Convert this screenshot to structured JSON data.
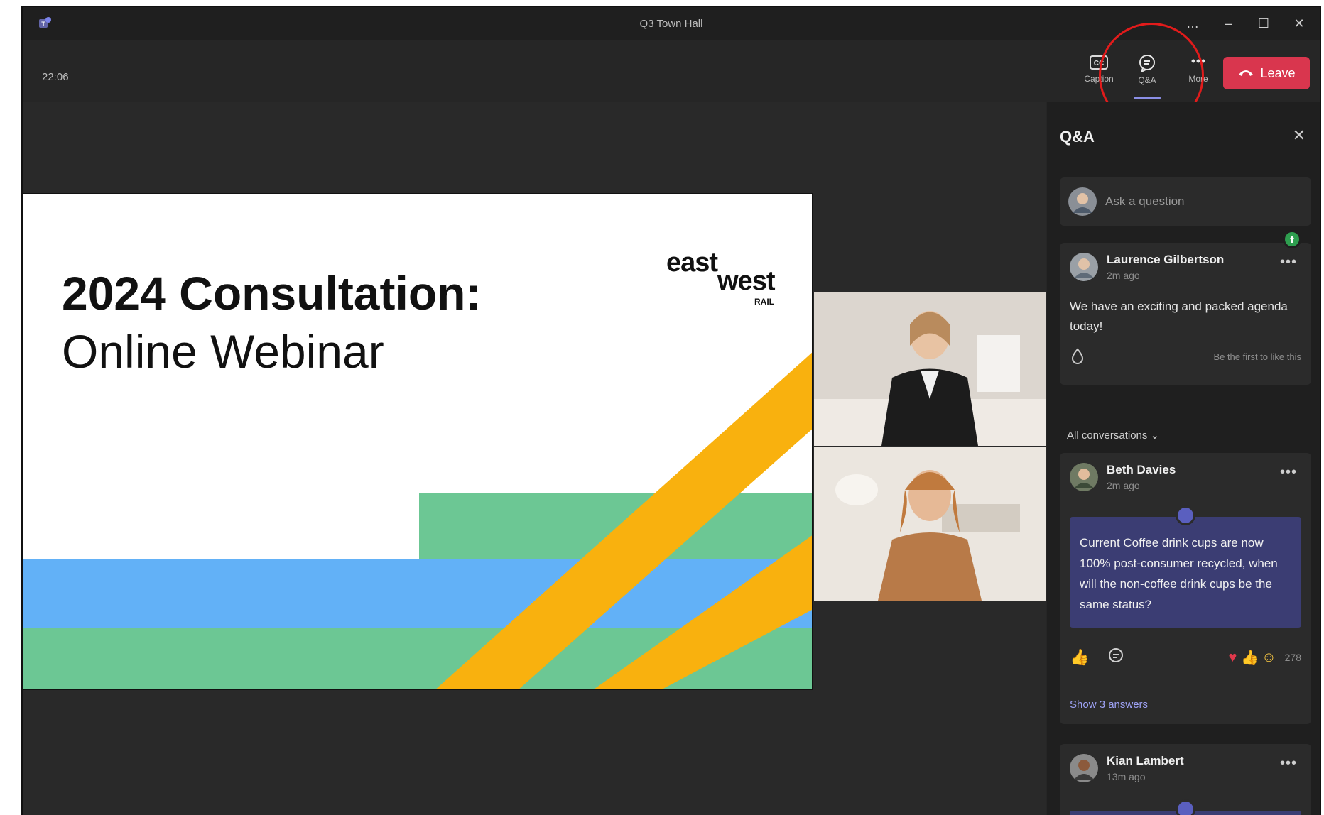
{
  "window": {
    "title": "Q3 Town Hall",
    "controls": [
      "…",
      "–",
      "☐",
      "✕"
    ]
  },
  "toolbar": {
    "timer": "22:06",
    "captions_label": "Caption",
    "qa_label": "Q&A",
    "more_label": "More",
    "leave_label": "Leave",
    "leave_color": "#d9364e",
    "active_indicator_color": "#8b8fe6"
  },
  "slide": {
    "title_bold": "2024 Consultation:",
    "title_light": "Online Webinar",
    "brand_east": "east",
    "brand_west": "west",
    "brand_rail": "RAIL",
    "colors": {
      "green": "#6cc794",
      "blue": "#62b1f7",
      "yellow": "#f9b10e"
    }
  },
  "qa": {
    "title": "Q&A",
    "close": "✕",
    "ask_placeholder": "Ask a question",
    "pinned": {
      "name": "Laurence Gilbertson",
      "time": "2m ago",
      "message": "We have an exciting and packed agenda today!",
      "like_hint": "Be the first to like this"
    },
    "filter_label": "All conversations ⌄",
    "questions": [
      {
        "name": "Beth Davies",
        "time": "2m ago",
        "question": "Current Coffee drink cups are now 100% post-consumer recycled, when will the non-coffee drink cups be the same status?",
        "reaction_count": "278",
        "show_answers": "Show 3 answers"
      },
      {
        "name": "Kian Lambert",
        "time": "13m ago"
      }
    ]
  }
}
